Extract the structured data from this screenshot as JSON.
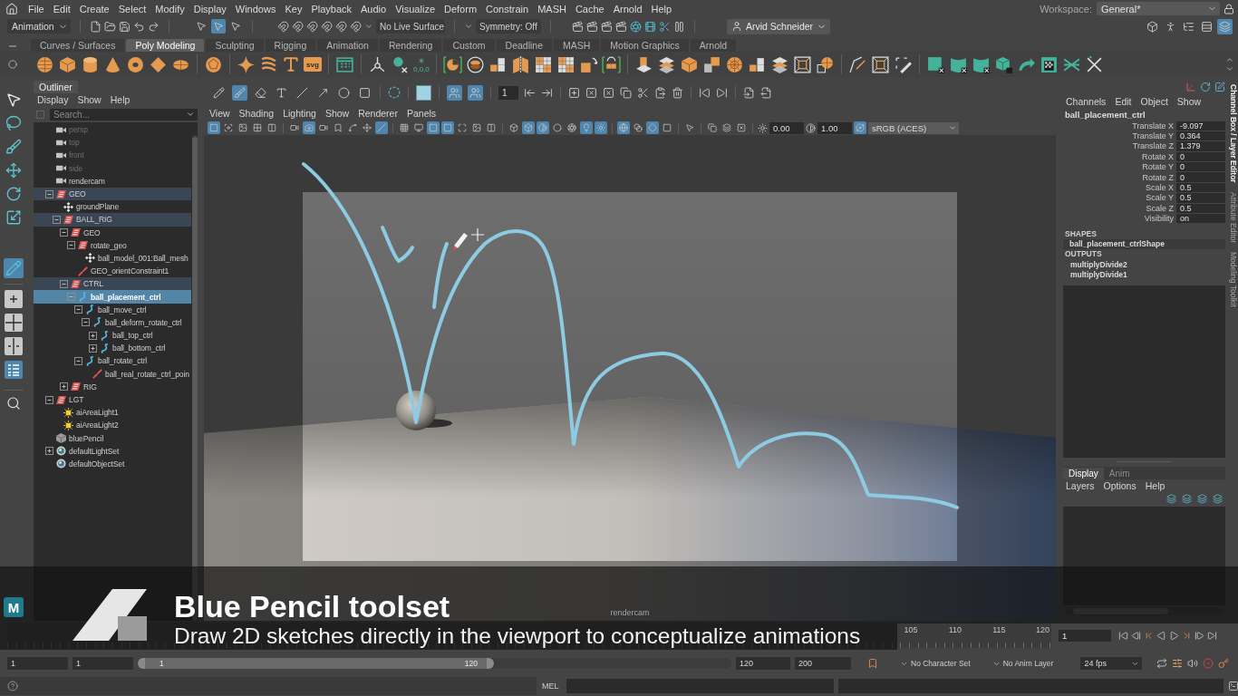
{
  "menu_bar": {
    "items": [
      "File",
      "Edit",
      "Create",
      "Select",
      "Modify",
      "Display",
      "Windows",
      "Key",
      "Playback",
      "Audio",
      "Visualize",
      "Deform",
      "Constrain",
      "MASH",
      "Cache",
      "Arnold",
      "Help"
    ],
    "workspace_label": "Workspace:",
    "workspace": "General*"
  },
  "status_line": {
    "menu_set": "Animation",
    "select_modes": [
      {
        "selected": false
      },
      {
        "selected": true
      },
      {
        "selected": false
      }
    ],
    "live_surface": "No Live Surface",
    "symmetry": "Symmetry: Off",
    "user": "Arvid Schneider",
    "layout_toggles": [
      {
        "on": false
      },
      {
        "on": false
      },
      {
        "on": false
      },
      {
        "on": false
      },
      {
        "on": true
      }
    ]
  },
  "shelf": {
    "tabs": [
      {
        "label": "Curves / Surfaces",
        "selected": false
      },
      {
        "label": "Poly Modeling",
        "selected": true
      },
      {
        "label": "Sculpting",
        "selected": false
      },
      {
        "label": "Rigging",
        "selected": false
      },
      {
        "label": "Animation",
        "selected": false
      },
      {
        "label": "Rendering",
        "selected": false
      },
      {
        "label": "Custom",
        "selected": false
      },
      {
        "label": "Deadline",
        "selected": false
      },
      {
        "label": "MASH",
        "selected": false
      },
      {
        "label": "Motion Graphics",
        "selected": false
      },
      {
        "label": "Arnold",
        "selected": false
      }
    ],
    "svg_label": "svg",
    "coords_label": "0,0,0"
  },
  "toolbox": {
    "tools": [
      {
        "selected": false
      },
      {
        "selected": false
      },
      {
        "selected": false
      },
      {
        "selected": false
      },
      {
        "selected": false
      },
      {
        "selected": false
      },
      {
        "selected": true
      }
    ],
    "layouts": [
      {
        "selected": false
      },
      {
        "selected": false
      },
      {
        "selected": false
      },
      {
        "selected": true
      }
    ],
    "logo_letter": "M"
  },
  "outliner": {
    "title": "Outliner",
    "menus": [
      "Display",
      "Show",
      "Help"
    ],
    "search": {
      "placeholder": "Search..."
    },
    "items": [
      {
        "label": "persp",
        "kind": "camera",
        "hidden": true,
        "selected": false,
        "highlighted": false
      },
      {
        "label": "top",
        "kind": "camera",
        "hidden": true,
        "selected": false,
        "highlighted": false
      },
      {
        "label": "front",
        "kind": "camera",
        "hidden": true,
        "selected": false,
        "highlighted": false
      },
      {
        "label": "side",
        "kind": "camera",
        "hidden": true,
        "selected": false,
        "highlighted": false
      },
      {
        "label": "rendercam",
        "kind": "camera",
        "hidden": false,
        "selected": false,
        "highlighted": false
      },
      {
        "label": "GEO",
        "kind": "group",
        "hidden": false,
        "selected": false,
        "highlighted": true,
        "expanded": true,
        "children": [
          {
            "label": "groundPlane",
            "kind": "mesh",
            "hidden": false,
            "selected": false,
            "highlighted": false
          },
          {
            "label": "BALL_RIG",
            "kind": "group",
            "hidden": false,
            "selected": false,
            "highlighted": true,
            "expanded": true,
            "children": [
              {
                "label": "GEO",
                "kind": "group",
                "hidden": false,
                "selected": false,
                "highlighted": false,
                "expanded": true,
                "children": [
                  {
                    "label": "rotate_geo",
                    "kind": "group",
                    "hidden": false,
                    "selected": false,
                    "highlighted": false,
                    "expanded": true,
                    "children": [
                      {
                        "label": "ball_model_001:Ball_mesh",
                        "kind": "mesh",
                        "hidden": false,
                        "selected": false,
                        "highlighted": false
                      }
                    ]
                  },
                  {
                    "label": "GEO_orientConstraint1",
                    "kind": "constraint",
                    "hidden": false,
                    "selected": false,
                    "highlighted": false
                  }
                ]
              },
              {
                "label": "CTRL",
                "kind": "group",
                "hidden": false,
                "selected": false,
                "highlighted": true,
                "expanded": true,
                "children": [
                  {
                    "label": "ball_placement_ctrl",
                    "kind": "curve",
                    "hidden": false,
                    "selected": true,
                    "highlighted": false,
                    "expanded": true,
                    "children": [
                      {
                        "label": "ball_move_ctrl",
                        "kind": "curve",
                        "hidden": false,
                        "selected": false,
                        "highlighted": false,
                        "expanded": true,
                        "children": [
                          {
                            "label": "ball_deform_rotate_ctrl",
                            "kind": "curve",
                            "hidden": false,
                            "selected": false,
                            "highlighted": false,
                            "expanded": true,
                            "children": [
                              {
                                "label": "ball_top_ctrl",
                                "kind": "curve",
                                "hidden": false,
                                "selected": false,
                                "highlighted": false,
                                "expanded": false
                              },
                              {
                                "label": "ball_bottom_ctrl",
                                "kind": "curve",
                                "hidden": false,
                                "selected": false,
                                "highlighted": false,
                                "expanded": false
                              }
                            ]
                          }
                        ]
                      },
                      {
                        "label": "ball_rotate_ctrl",
                        "kind": "curve",
                        "hidden": false,
                        "selected": false,
                        "highlighted": false,
                        "expanded": true,
                        "children": [
                          {
                            "label": "ball_real_rotate_ctrl_poin",
                            "kind": "constraint",
                            "hidden": false,
                            "selected": false,
                            "highlighted": false
                          }
                        ]
                      }
                    ]
                  }
                ]
              },
              {
                "label": "RIG",
                "kind": "group",
                "hidden": false,
                "selected": false,
                "highlighted": false,
                "expanded": false
              }
            ]
          }
        ]
      },
      {
        "label": "LGT",
        "kind": "group",
        "hidden": false,
        "selected": false,
        "highlighted": false,
        "expanded": true,
        "children": [
          {
            "label": "aiAreaLight1",
            "kind": "light",
            "hidden": false,
            "selected": false,
            "highlighted": false
          },
          {
            "label": "aiAreaLight2",
            "kind": "light",
            "hidden": false,
            "selected": false,
            "highlighted": false
          }
        ]
      },
      {
        "label": "bluePencil",
        "kind": "pencil",
        "hidden": false,
        "selected": false,
        "highlighted": false
      },
      {
        "label": "defaultLightSet",
        "kind": "set",
        "hidden": false,
        "selected": false,
        "highlighted": false,
        "expanded": false
      },
      {
        "label": "defaultObjectSet",
        "kind": "set",
        "hidden": false,
        "selected": false,
        "highlighted": false
      }
    ]
  },
  "viewport": {
    "tools": [
      {
        "selected": false
      },
      {
        "selected": true
      },
      {
        "selected": false
      },
      {
        "selected": false
      },
      {
        "selected": false
      },
      {
        "selected": false
      },
      {
        "selected": false
      },
      {
        "selected": false
      }
    ],
    "ghost_toggles": [
      {
        "on": true
      },
      {
        "on": true
      }
    ],
    "frame": "1",
    "menus": [
      "View",
      "Shading",
      "Lighting",
      "Show",
      "Renderer",
      "Panels"
    ],
    "panel_toggles": [
      {
        "on": true
      },
      {
        "on": false
      },
      {
        "on": false
      },
      {
        "on": false
      },
      {
        "on": false
      },
      {
        "on": false
      },
      {
        "on": true
      },
      {
        "on": false
      },
      {
        "on": false
      },
      {
        "on": false
      },
      {
        "on": false
      },
      {
        "on": true
      },
      {
        "on": false
      },
      {
        "on": false
      },
      {
        "on": true
      },
      {
        "on": true
      },
      {
        "on": false
      },
      {
        "on": false
      },
      {
        "on": false
      },
      {
        "on": false
      },
      {
        "on": true
      },
      {
        "on": true
      },
      {
        "on": false
      },
      {
        "on": false
      },
      {
        "on": true
      },
      {
        "on": true
      },
      {
        "on": true
      },
      {
        "on": false
      },
      {
        "on": true
      },
      {
        "on": false
      },
      {
        "on": false
      },
      {
        "on": false
      },
      {
        "on": false
      },
      {
        "on": false
      }
    ],
    "exposure": "0.00",
    "gamma": "1.00",
    "color_management": {
      "on": true
    },
    "color_space": "sRGB (ACES)",
    "camera": "rendercam"
  },
  "channel_box": {
    "menus": [
      "Channels",
      "Edit",
      "Object",
      "Show"
    ],
    "object": "ball_placement_ctrl",
    "channels": [
      {
        "name": "Translate X",
        "value": "-9.097"
      },
      {
        "name": "Translate Y",
        "value": "0.364"
      },
      {
        "name": "Translate Z",
        "value": "1.379"
      },
      {
        "name": "Rotate X",
        "value": "0"
      },
      {
        "name": "Rotate Y",
        "value": "0"
      },
      {
        "name": "Rotate Z",
        "value": "0"
      },
      {
        "name": "Scale X",
        "value": "0.5"
      },
      {
        "name": "Scale Y",
        "value": "0.5"
      },
      {
        "name": "Scale Z",
        "value": "0.5"
      },
      {
        "name": "Visibility",
        "value": "on"
      }
    ],
    "shapes_heading": "SHAPES",
    "shapes": [
      "ball_placement_ctrlShape"
    ],
    "outputs_heading": "OUTPUTS",
    "outputs": [
      "multiplyDivide2",
      "multiplyDivide1"
    ]
  },
  "layer_editor": {
    "tabs": [
      {
        "label": "Display",
        "selected": true
      },
      {
        "label": "Anim",
        "selected": false
      }
    ],
    "menus": [
      "Layers",
      "Options",
      "Help"
    ]
  },
  "side_tabs": [
    {
      "label": "Channel Box / Layer Editor",
      "selected": true
    },
    {
      "label": "Attribute Editor",
      "selected": false
    },
    {
      "label": "Modeling Toolkit",
      "selected": false
    }
  ],
  "time_slider": {
    "ticks": [
      "105",
      "110",
      "115",
      "120"
    ],
    "current_frame": "1"
  },
  "range_slider": {
    "start": "1",
    "playback_start": "1",
    "level": 0.6,
    "handle_start": "1",
    "handle_end": "120",
    "playback_end": "120",
    "end": "200",
    "character_set": "No Character Set",
    "anim_layer": "No Anim Layer",
    "fps": "24 fps"
  },
  "command_line": {
    "language": "MEL"
  },
  "caption": {
    "title": "Blue Pencil toolset",
    "subtitle": "Draw 2D sketches directly in the viewport to conceptualize animations"
  }
}
